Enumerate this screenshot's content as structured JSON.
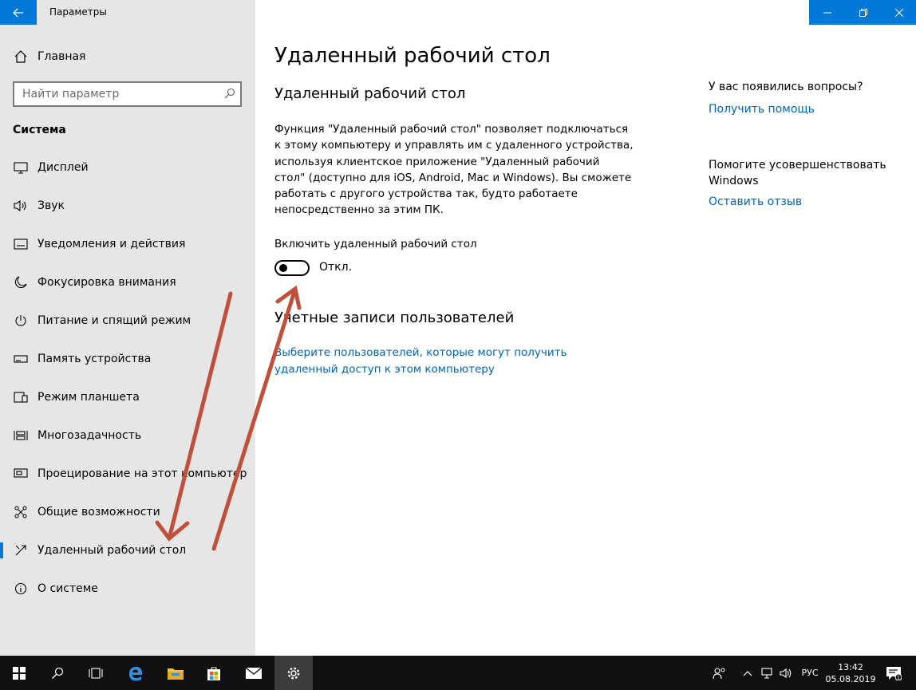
{
  "window": {
    "title": "Параметры"
  },
  "sidebar": {
    "home_label": "Главная",
    "search_placeholder": "Найти параметр",
    "section_title": "Система",
    "items": [
      {
        "label": "Дисплей",
        "icon": "display-icon"
      },
      {
        "label": "Звук",
        "icon": "speaker-icon"
      },
      {
        "label": "Уведомления и действия",
        "icon": "notifications-icon"
      },
      {
        "label": "Фокусировка внимания",
        "icon": "moon-icon"
      },
      {
        "label": "Питание и спящий режим",
        "icon": "power-icon"
      },
      {
        "label": "Память устройства",
        "icon": "storage-icon"
      },
      {
        "label": "Режим планшета",
        "icon": "tablet-icon"
      },
      {
        "label": "Многозадачность",
        "icon": "multitasking-icon"
      },
      {
        "label": "Проецирование на этот компьютер",
        "icon": "projection-icon"
      },
      {
        "label": "Общие возможности",
        "icon": "shared-experiences-icon"
      },
      {
        "label": "Удаленный рабочий стол",
        "icon": "remote-desktop-icon",
        "selected": true
      },
      {
        "label": "О системе",
        "icon": "info-icon"
      }
    ]
  },
  "main": {
    "page_title": "Удаленный рабочий стол",
    "section_title": "Удаленный рабочий стол",
    "description": "Функция \"Удаленный рабочий стол\" позволяет подключаться к этому компьютеру и управлять им с удаленного устройства, используя клиентское приложение \"Удаленный рабочий стол\" (доступно для iOS, Android, Mac и Windows). Вы сможете работать с другого устройства так, будто работаете непосредственно за этим ПК.",
    "toggle_label": "Включить удаленный рабочий стол",
    "toggle_state": "Откл.",
    "toggle_on": false,
    "accounts_title": "Учетные записи пользователей",
    "accounts_link": "Выберите пользователей, которые могут получить удаленный доступ к этом компьютеру"
  },
  "aside": {
    "question": "У вас появились вопросы?",
    "help_link": "Получить помощь",
    "improve_text": "Помогите усовершенствовать Windows",
    "feedback_link": "Оставить отзыв"
  },
  "taskbar": {
    "language": "РУС",
    "time": "13:42",
    "date": "05.08.2019",
    "notification_count": "1"
  },
  "colors": {
    "accent": "#0078d7",
    "link": "#0063b1",
    "sidebar_bg": "#e6e6e6",
    "taskbar_bg": "#101010",
    "annotation_arrow": "#c0503a"
  }
}
